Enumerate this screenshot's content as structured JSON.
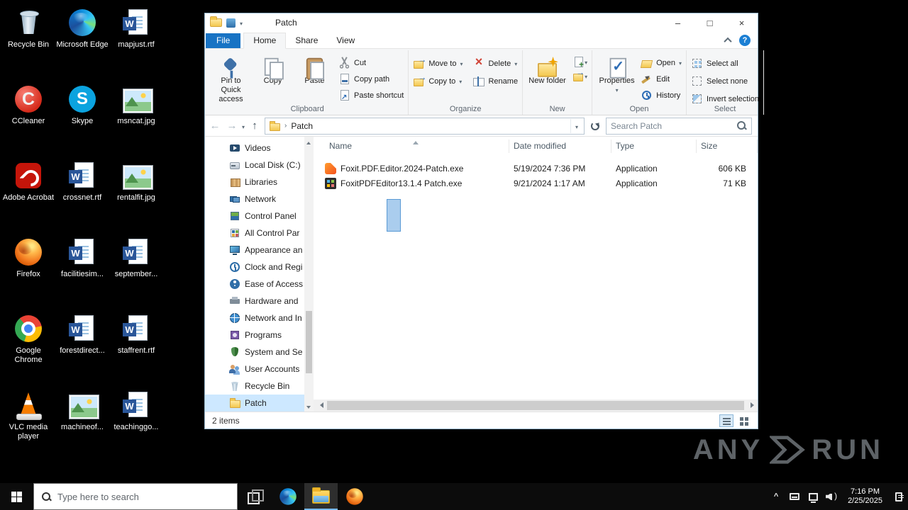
{
  "desktop": {
    "icons": [
      {
        "label": "Recycle Bin",
        "kind": "recycle-bin"
      },
      {
        "label": "CCleaner",
        "kind": "ccleaner"
      },
      {
        "label": "Adobe Acrobat",
        "kind": "acrobat"
      },
      {
        "label": "Firefox",
        "kind": "firefox"
      },
      {
        "label": "Google Chrome",
        "kind": "chrome"
      },
      {
        "label": "VLC media player",
        "kind": "vlc"
      },
      {
        "label": "Microsoft Edge",
        "kind": "edge"
      },
      {
        "label": "Skype",
        "kind": "skype"
      },
      {
        "label": "crossnet.rtf",
        "kind": "word"
      },
      {
        "label": "facilitiesim...",
        "kind": "word"
      },
      {
        "label": "forestdirect...",
        "kind": "word"
      },
      {
        "label": "machineof...",
        "kind": "image"
      },
      {
        "label": "mapjust.rtf",
        "kind": "word"
      },
      {
        "label": "msncat.jpg",
        "kind": "image"
      },
      {
        "label": "rentalfit.jpg",
        "kind": "image"
      },
      {
        "label": "september...",
        "kind": "word"
      },
      {
        "label": "staffrent.rtf",
        "kind": "word"
      },
      {
        "label": "teachinggo...",
        "kind": "word"
      }
    ]
  },
  "window": {
    "title": "Patch",
    "controls": {
      "minimize": "–",
      "maximize": "□",
      "close": "×"
    },
    "tabs": {
      "file": "File",
      "home": "Home",
      "share": "Share",
      "view": "View"
    },
    "help_label": "?",
    "ribbon": {
      "clipboard": {
        "label": "Clipboard",
        "pin": "Pin to Quick access",
        "copy": "Copy",
        "paste": "Paste",
        "cut": "Cut",
        "copy_path": "Copy path",
        "paste_shortcut": "Paste shortcut"
      },
      "organize": {
        "label": "Organize",
        "move_to": "Move to",
        "copy_to": "Copy to",
        "delete": "Delete",
        "rename": "Rename"
      },
      "new_group": {
        "label": "New",
        "new_folder": "New folder"
      },
      "open_group": {
        "label": "Open",
        "properties": "Properties",
        "open": "Open",
        "edit": "Edit",
        "history": "History"
      },
      "select_group": {
        "label": "Select",
        "select_all": "Select all",
        "select_none": "Select none",
        "invert_selection": "Invert selection"
      }
    },
    "address": {
      "crumb": "Patch",
      "search_placeholder": "Search Patch"
    },
    "nav": {
      "items": [
        {
          "label": "Videos",
          "kind": "videos"
        },
        {
          "label": "Local Disk (C:)",
          "kind": "local-disk"
        },
        {
          "label": "Libraries",
          "kind": "libraries"
        },
        {
          "label": "Network",
          "kind": "network"
        },
        {
          "label": "Control Panel",
          "kind": "control-panel"
        },
        {
          "label": "All Control Par",
          "kind": "all-control-panel-items"
        },
        {
          "label": "Appearance an",
          "kind": "appearance-personalization"
        },
        {
          "label": "Clock and Regi",
          "kind": "clock-region"
        },
        {
          "label": "Ease of Access",
          "kind": "ease-of-access"
        },
        {
          "label": "Hardware and",
          "kind": "hardware-sound"
        },
        {
          "label": "Network and In",
          "kind": "network-internet"
        },
        {
          "label": "Programs",
          "kind": "programs"
        },
        {
          "label": "System and Se",
          "kind": "system-security"
        },
        {
          "label": "User Accounts",
          "kind": "user-accounts"
        },
        {
          "label": "Recycle Bin",
          "kind": "recycle-bin"
        },
        {
          "label": "Patch",
          "kind": "folder",
          "selected": true
        }
      ]
    },
    "list": {
      "columns": {
        "name": "Name",
        "modified": "Date modified",
        "type": "Type",
        "size": "Size"
      },
      "sort": {
        "column": "Name",
        "direction": "ascending"
      },
      "files": [
        {
          "name": "Foxit.PDF.Editor.2024-Patch.exe",
          "modified": "5/19/2024 7:36 PM",
          "type": "Application",
          "size": "606 KB",
          "kind": "foxit-exe"
        },
        {
          "name": "FoxitPDFEditor13.1.4 Patch.exe",
          "modified": "9/21/2024 1:17 AM",
          "type": "Application",
          "size": "71 KB",
          "kind": "generic-exe"
        }
      ]
    },
    "status": {
      "items_count": "2 items"
    }
  },
  "taskbar": {
    "search_placeholder": "Type here to search",
    "clock": {
      "time": "7:16 PM",
      "date": "2/25/2025"
    }
  },
  "watermark": {
    "left": "ANY",
    "right": "RUN"
  }
}
